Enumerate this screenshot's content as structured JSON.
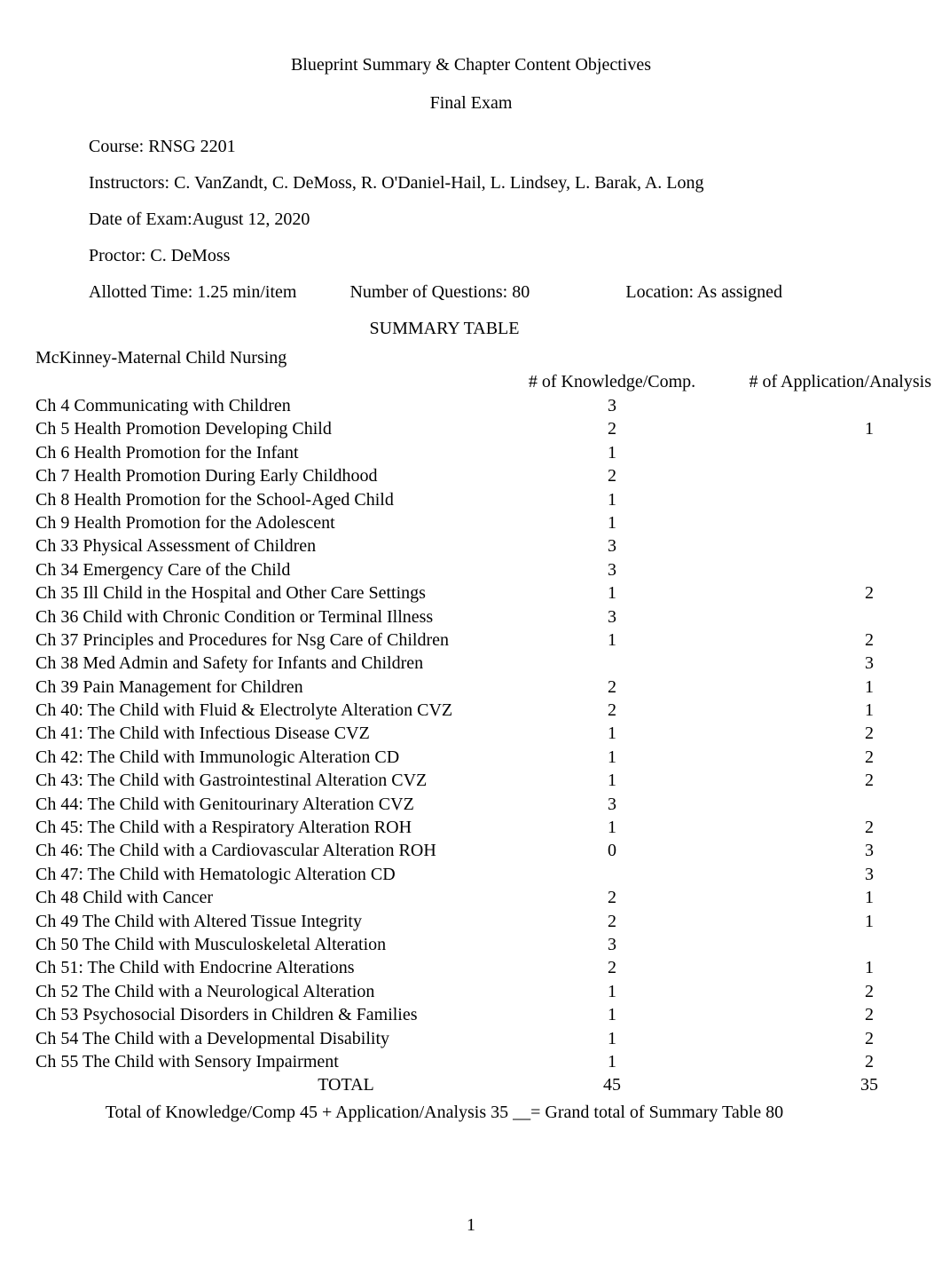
{
  "header": {
    "title": "Blueprint Summary & Chapter Content Objectives",
    "subtitle": "Final Exam"
  },
  "meta": {
    "course": "Course: RNSG 2201",
    "instructors": "Instructors: C. VanZandt, C. DeMoss, R. O'Daniel-Hail, L. Lindsey, L. Barak, A. Long",
    "exam_date": "Date of Exam:August 12, 2020",
    "proctor": "Proctor: C. DeMoss",
    "allotted_time": "Allotted Time: 1.25 min/item",
    "num_questions": "Number of Questions: 80",
    "location": "Location: As assigned",
    "summary_label": "SUMMARY TABLE"
  },
  "table": {
    "book_title": "McKinney-Maternal Child Nursing",
    "col_kc": "# of Knowledge/Comp.",
    "col_aa": "# of Application/Analysis",
    "rows": [
      {
        "ch": "Ch 4 Communicating with Children",
        "kc": "3",
        "aa": ""
      },
      {
        "ch": "Ch 5 Health Promotion Developing Child",
        "kc": "2",
        "aa": "1"
      },
      {
        "ch": "Ch 6 Health Promotion for the Infant",
        "kc": "1",
        "aa": ""
      },
      {
        "ch": "Ch 7 Health Promotion During Early Childhood",
        "kc": "2",
        "aa": ""
      },
      {
        "ch": "Ch 8 Health Promotion for the School-Aged Child",
        "kc": "1",
        "aa": ""
      },
      {
        "ch": "Ch 9 Health Promotion for the Adolescent",
        "kc": "1",
        "aa": ""
      },
      {
        "ch": "Ch 33 Physical Assessment of Children",
        "kc": "3",
        "aa": ""
      },
      {
        "ch": "Ch 34 Emergency Care of the Child",
        "kc": "3",
        "aa": ""
      },
      {
        "ch": "Ch 35 Ill Child in the Hospital and Other Care Settings",
        "kc": "1",
        "aa": "2"
      },
      {
        "ch": "Ch 36 Child with Chronic Condition or Terminal Illness",
        "kc": "3",
        "aa": ""
      },
      {
        "ch": "Ch 37 Principles and Procedures for Nsg Care of Children",
        "kc": "1",
        "aa": "2"
      },
      {
        "ch": "Ch 38 Med Admin and Safety for Infants and Children",
        "kc": "",
        "aa": "3"
      },
      {
        "ch": "Ch 39 Pain Management for Children",
        "kc": "2",
        "aa": "1"
      },
      {
        "ch": "Ch 40: The Child with Fluid & Electrolyte Alteration CVZ",
        "kc": "2",
        "aa": "1"
      },
      {
        "ch": "Ch 41: The Child with Infectious Disease CVZ",
        "kc": "1",
        "aa": "2"
      },
      {
        "ch": "Ch 42: The Child with Immunologic Alteration CD",
        "kc": "1",
        "aa": "2"
      },
      {
        "ch": "Ch 43: The Child with Gastrointestinal Alteration CVZ",
        "kc": "1",
        "aa": "2"
      },
      {
        "ch": "Ch 44: The Child with Genitourinary Alteration CVZ",
        "kc": "3",
        "aa": ""
      },
      {
        "ch": "Ch 45: The Child with a Respiratory Alteration ROH",
        "kc": "1",
        "aa": "2"
      },
      {
        "ch": "Ch 46: The Child with a Cardiovascular Alteration ROH",
        "kc": "0",
        "aa": "3"
      },
      {
        "ch": "Ch 47: The Child with Hematologic Alteration CD",
        "kc": "",
        "aa": "3"
      },
      {
        "ch": "Ch 48 Child with Cancer",
        "kc": "2",
        "aa": "1"
      },
      {
        "ch": "Ch 49 The Child with Altered Tissue Integrity",
        "kc": "2",
        "aa": "1"
      },
      {
        "ch": "Ch 50 The Child with Musculoskeletal Alteration",
        "kc": "3",
        "aa": ""
      },
      {
        "ch": "Ch 51: The Child with Endocrine Alterations",
        "kc": "2",
        "aa": "1"
      },
      {
        "ch": "Ch 52 The Child with a Neurological Alteration",
        "kc": "1",
        "aa": "2"
      },
      {
        "ch": "Ch 53 Psychosocial Disorders in Children & Families",
        "kc": "1",
        "aa": "2"
      },
      {
        "ch": "Ch 54 The Child with a Developmental Disability",
        "kc": "1",
        "aa": "2"
      },
      {
        "ch": "Ch 55 The Child with Sensory Impairment",
        "kc": "1",
        "aa": "2"
      }
    ],
    "total": {
      "label": "TOTAL",
      "kc": "45",
      "aa": "35"
    },
    "grand_line": "Total of Knowledge/Comp   45    + Application/Analysis    35  __= Grand total of Summary Table  80"
  },
  "page_number": "1"
}
